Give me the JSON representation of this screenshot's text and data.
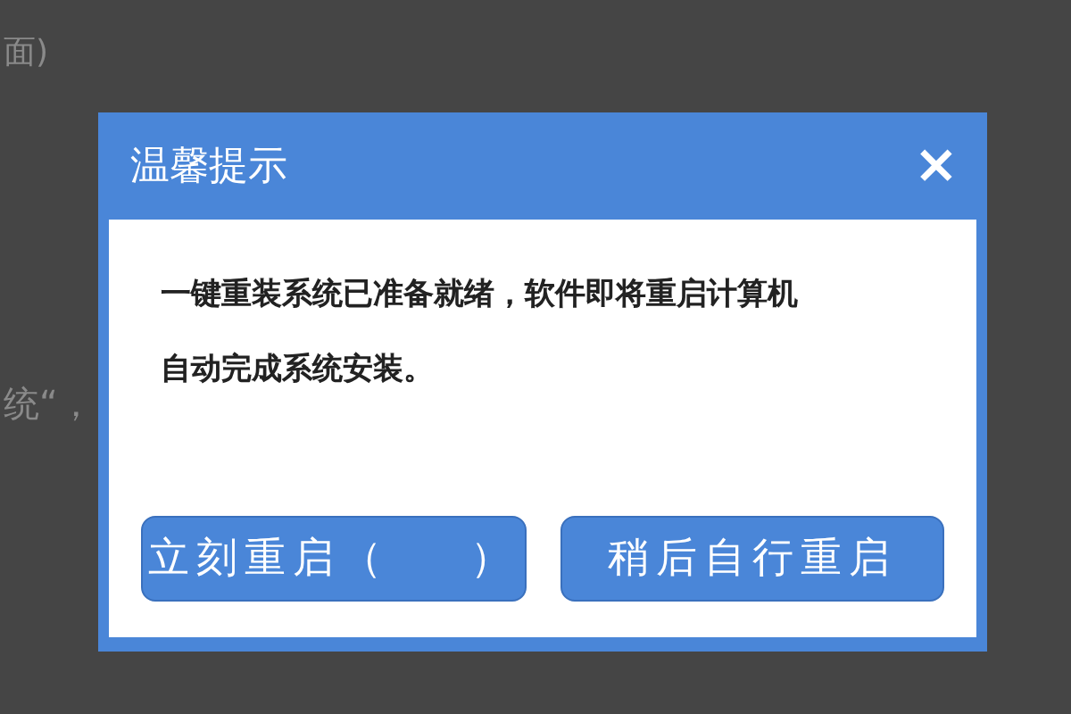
{
  "background": {
    "texts": [
      "面)",
      "统“，"
    ]
  },
  "dialog": {
    "title": "温馨提示",
    "close": "×",
    "message": [
      "一键重装系统已准备就绪，软件即将重启计算机",
      "自动完成系统安装。"
    ],
    "buttons": [
      "立刻重启（    ）",
      "稍后自行重启"
    ]
  }
}
